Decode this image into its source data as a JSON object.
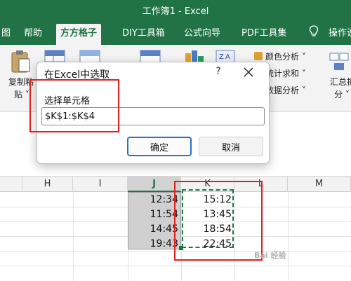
{
  "window": {
    "title": "工作簿1  -  Excel"
  },
  "tabs": [
    "图",
    "帮助",
    "方方格子",
    "DIY工具箱",
    "公式向导",
    "PDF工具集",
    "操作说"
  ],
  "ribbon": {
    "copy_label": "复制粘",
    "paste_label": "贴",
    "menu_items": [
      "颜色分析",
      "统计求和",
      "数据分析"
    ],
    "summary_label_1": "汇总拆",
    "summary_label_2": "分"
  },
  "dialog": {
    "title": "在Excel中选取",
    "help": "?",
    "field_label": "选择单元格",
    "field_value": "$K$1:$K$4",
    "ok_label": "确定",
    "cancel_label": "取消"
  },
  "sheet": {
    "columns": [
      "H",
      "I",
      "J",
      "K",
      "L",
      "M"
    ],
    "j_values": [
      "12:34",
      "11:54",
      "14:45",
      "19:43"
    ],
    "k_values": [
      "15:12",
      "13:45",
      "18:54",
      "22:45"
    ]
  },
  "watermark": "Bai 经验",
  "colors": {
    "excel_green": "#217346",
    "highlight_red": "#e02020",
    "primary_blue": "#2f6fcf"
  }
}
